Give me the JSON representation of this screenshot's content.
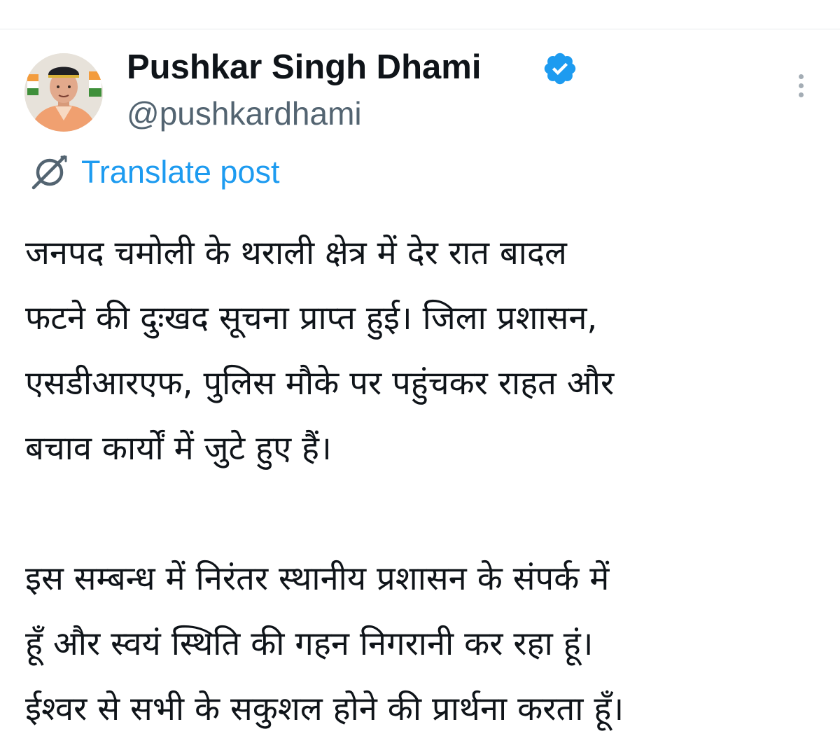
{
  "tweet": {
    "author": {
      "display_name": "Pushkar Singh Dhami",
      "handle": "@pushkardhami",
      "verified": true,
      "verified_badge_color": "#1d9bf0",
      "avatar_icon": "profile-photo"
    },
    "translate_label": "Translate post",
    "translate_icon": "globe-slash-icon",
    "more_icon": "vertical-ellipsis-icon",
    "text_paragraphs": [
      {
        "lines": [
          "जनपद चमोली के थराली क्षेत्र में देर रात बादल",
          "फटने की दुःखद सूचना प्राप्त हुई। जिला प्रशासन,",
          "एसडीआरएफ, पुलिस मौके पर पहुंचकर राहत और",
          "बचाव कार्यों में जुटे हुए हैं।"
        ]
      },
      {
        "lines": [
          "इस सम्बन्ध में निरंतर स्थानीय प्रशासन के संपर्क में",
          "हूँ और स्वयं स्थिति की गहन निगरानी कर रहा हूं।",
          "ईश्वर से सभी के सकुशल होने की प्रार्थना करता हूँ।"
        ]
      }
    ]
  },
  "colors": {
    "text_primary": "#0f1419",
    "text_secondary": "#536471",
    "link": "#1d9bf0",
    "divider": "#e6e9ec"
  }
}
